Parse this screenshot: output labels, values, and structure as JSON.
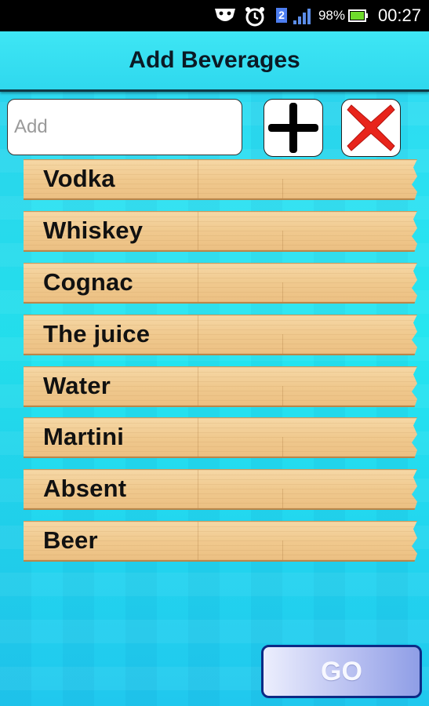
{
  "status_bar": {
    "notification_badge": "2",
    "battery_percent": "98%",
    "time": "00:27"
  },
  "header": {
    "title": "Add Beverages"
  },
  "add_field": {
    "value": "",
    "placeholder": "Add"
  },
  "toolbar": {
    "add_icon": "plus-icon",
    "delete_icon": "delete-x-icon"
  },
  "beverages": [
    {
      "label": "Vodka"
    },
    {
      "label": "Whiskey"
    },
    {
      "label": "Cognac"
    },
    {
      "label": "The juice"
    },
    {
      "label": "Water"
    },
    {
      "label": "Martini"
    },
    {
      "label": "Absent"
    },
    {
      "label": "Beer"
    }
  ],
  "footer": {
    "go_label": "GO"
  },
  "colors": {
    "background": "#2ee0ea",
    "plank": "#f0c98e",
    "delete_red": "#e8241b",
    "go_border": "#0d2a86"
  }
}
